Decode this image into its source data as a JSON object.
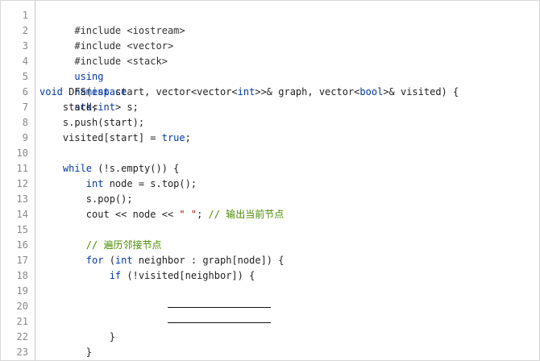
{
  "line_numbers": [
    "1",
    "2",
    "3",
    "4",
    "5",
    "6",
    "7",
    "8",
    "9",
    "10",
    "11",
    "12",
    "13",
    "14",
    "15",
    "16",
    "17",
    "18",
    "19",
    "20",
    "21",
    "22",
    "23"
  ],
  "code": {
    "l1": {
      "text": "#include <iostream>"
    },
    "l2": {
      "text": "#include <vector>"
    },
    "l3": {
      "text": "#include <stack>"
    },
    "l4": {
      "kw1": "using",
      "kw2": "namespace",
      "kw3": "std",
      "rest": ";"
    },
    "l6": {
      "ret": "void",
      "fn": " DFS(",
      "t1": "int",
      "p1": " start, vector<vector<",
      "t2": "int",
      "p2": ">>& graph, vector<",
      "t3": "bool",
      "p3": ">& visited) {"
    },
    "l7": {
      "a": "    stack<",
      "t": "int",
      "b": "> s;"
    },
    "l8": {
      "text": "    s.push(start);"
    },
    "l9": {
      "a": "    visited[start] = ",
      "kw": "true",
      "b": ";"
    },
    "l11": {
      "a": "    ",
      "kw": "while",
      "b": " (!s.empty()) {"
    },
    "l12": {
      "a": "        ",
      "t": "int",
      "b": " node = s.top();"
    },
    "l13": {
      "text": "        s.pop();"
    },
    "l14": {
      "a": "        cout << node << ",
      "s": "\" \"",
      "b": "; ",
      "c": "// 输出当前节点"
    },
    "l16": {
      "a": "        ",
      "c": "// 遍历邻接节点"
    },
    "l17": {
      "a": "        ",
      "kw": "for",
      "b": " (",
      "t": "int",
      "c": " neighbor : graph[node]) {"
    },
    "l18": {
      "a": "            ",
      "kw": "if",
      "b": " (!visited[neighbor]) {"
    },
    "l22": {
      "text": "            }"
    },
    "l23": {
      "text": "        }"
    }
  }
}
